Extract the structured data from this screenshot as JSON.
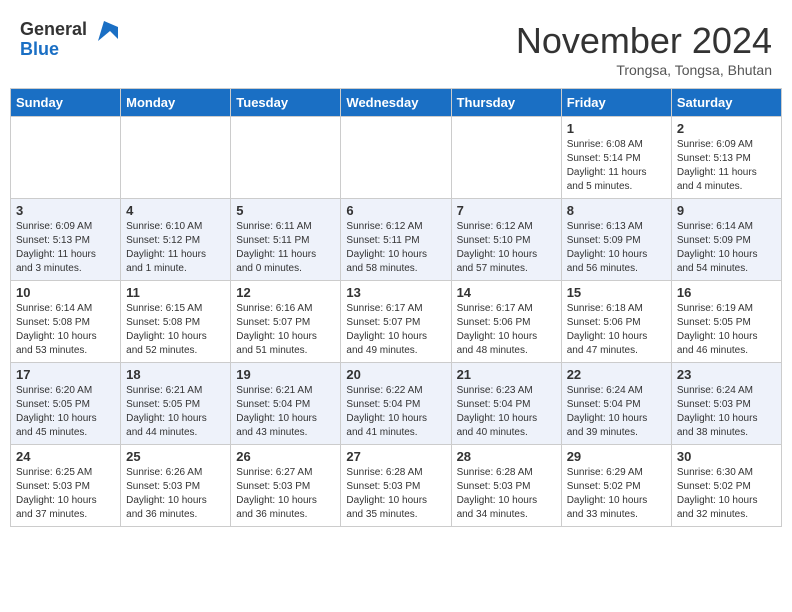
{
  "header": {
    "logo_general": "General",
    "logo_blue": "Blue",
    "month_title": "November 2024",
    "location": "Trongsa, Tongsa, Bhutan"
  },
  "days_of_week": [
    "Sunday",
    "Monday",
    "Tuesday",
    "Wednesday",
    "Thursday",
    "Friday",
    "Saturday"
  ],
  "weeks": [
    [
      {
        "day": "",
        "info": ""
      },
      {
        "day": "",
        "info": ""
      },
      {
        "day": "",
        "info": ""
      },
      {
        "day": "",
        "info": ""
      },
      {
        "day": "",
        "info": ""
      },
      {
        "day": "1",
        "info": "Sunrise: 6:08 AM\nSunset: 5:14 PM\nDaylight: 11 hours\nand 5 minutes."
      },
      {
        "day": "2",
        "info": "Sunrise: 6:09 AM\nSunset: 5:13 PM\nDaylight: 11 hours\nand 4 minutes."
      }
    ],
    [
      {
        "day": "3",
        "info": "Sunrise: 6:09 AM\nSunset: 5:13 PM\nDaylight: 11 hours\nand 3 minutes."
      },
      {
        "day": "4",
        "info": "Sunrise: 6:10 AM\nSunset: 5:12 PM\nDaylight: 11 hours\nand 1 minute."
      },
      {
        "day": "5",
        "info": "Sunrise: 6:11 AM\nSunset: 5:11 PM\nDaylight: 11 hours\nand 0 minutes."
      },
      {
        "day": "6",
        "info": "Sunrise: 6:12 AM\nSunset: 5:11 PM\nDaylight: 10 hours\nand 58 minutes."
      },
      {
        "day": "7",
        "info": "Sunrise: 6:12 AM\nSunset: 5:10 PM\nDaylight: 10 hours\nand 57 minutes."
      },
      {
        "day": "8",
        "info": "Sunrise: 6:13 AM\nSunset: 5:09 PM\nDaylight: 10 hours\nand 56 minutes."
      },
      {
        "day": "9",
        "info": "Sunrise: 6:14 AM\nSunset: 5:09 PM\nDaylight: 10 hours\nand 54 minutes."
      }
    ],
    [
      {
        "day": "10",
        "info": "Sunrise: 6:14 AM\nSunset: 5:08 PM\nDaylight: 10 hours\nand 53 minutes."
      },
      {
        "day": "11",
        "info": "Sunrise: 6:15 AM\nSunset: 5:08 PM\nDaylight: 10 hours\nand 52 minutes."
      },
      {
        "day": "12",
        "info": "Sunrise: 6:16 AM\nSunset: 5:07 PM\nDaylight: 10 hours\nand 51 minutes."
      },
      {
        "day": "13",
        "info": "Sunrise: 6:17 AM\nSunset: 5:07 PM\nDaylight: 10 hours\nand 49 minutes."
      },
      {
        "day": "14",
        "info": "Sunrise: 6:17 AM\nSunset: 5:06 PM\nDaylight: 10 hours\nand 48 minutes."
      },
      {
        "day": "15",
        "info": "Sunrise: 6:18 AM\nSunset: 5:06 PM\nDaylight: 10 hours\nand 47 minutes."
      },
      {
        "day": "16",
        "info": "Sunrise: 6:19 AM\nSunset: 5:05 PM\nDaylight: 10 hours\nand 46 minutes."
      }
    ],
    [
      {
        "day": "17",
        "info": "Sunrise: 6:20 AM\nSunset: 5:05 PM\nDaylight: 10 hours\nand 45 minutes."
      },
      {
        "day": "18",
        "info": "Sunrise: 6:21 AM\nSunset: 5:05 PM\nDaylight: 10 hours\nand 44 minutes."
      },
      {
        "day": "19",
        "info": "Sunrise: 6:21 AM\nSunset: 5:04 PM\nDaylight: 10 hours\nand 43 minutes."
      },
      {
        "day": "20",
        "info": "Sunrise: 6:22 AM\nSunset: 5:04 PM\nDaylight: 10 hours\nand 41 minutes."
      },
      {
        "day": "21",
        "info": "Sunrise: 6:23 AM\nSunset: 5:04 PM\nDaylight: 10 hours\nand 40 minutes."
      },
      {
        "day": "22",
        "info": "Sunrise: 6:24 AM\nSunset: 5:04 PM\nDaylight: 10 hours\nand 39 minutes."
      },
      {
        "day": "23",
        "info": "Sunrise: 6:24 AM\nSunset: 5:03 PM\nDaylight: 10 hours\nand 38 minutes."
      }
    ],
    [
      {
        "day": "24",
        "info": "Sunrise: 6:25 AM\nSunset: 5:03 PM\nDaylight: 10 hours\nand 37 minutes."
      },
      {
        "day": "25",
        "info": "Sunrise: 6:26 AM\nSunset: 5:03 PM\nDaylight: 10 hours\nand 36 minutes."
      },
      {
        "day": "26",
        "info": "Sunrise: 6:27 AM\nSunset: 5:03 PM\nDaylight: 10 hours\nand 36 minutes."
      },
      {
        "day": "27",
        "info": "Sunrise: 6:28 AM\nSunset: 5:03 PM\nDaylight: 10 hours\nand 35 minutes."
      },
      {
        "day": "28",
        "info": "Sunrise: 6:28 AM\nSunset: 5:03 PM\nDaylight: 10 hours\nand 34 minutes."
      },
      {
        "day": "29",
        "info": "Sunrise: 6:29 AM\nSunset: 5:02 PM\nDaylight: 10 hours\nand 33 minutes."
      },
      {
        "day": "30",
        "info": "Sunrise: 6:30 AM\nSunset: 5:02 PM\nDaylight: 10 hours\nand 32 minutes."
      }
    ]
  ]
}
